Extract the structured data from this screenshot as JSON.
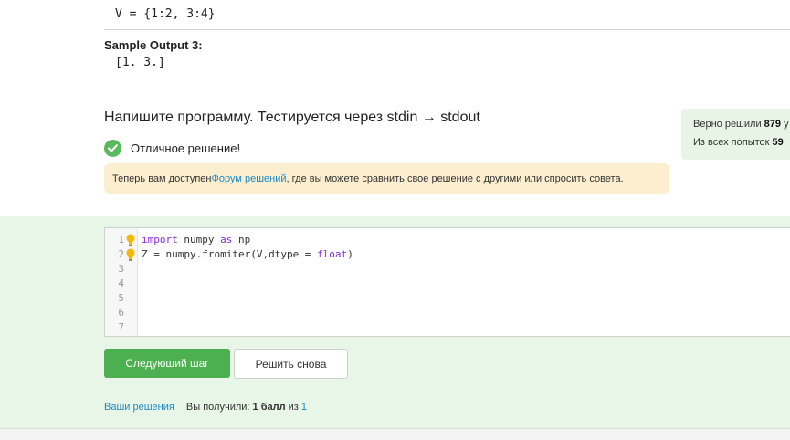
{
  "sample": {
    "input_value": "V = {1:2, 3:4}",
    "output_title": "Sample Output 3:",
    "output_value": "[1. 3.]"
  },
  "task": {
    "heading": "Напишите программу. Тестируется через stdin → stdout",
    "success_text": "Отличное решение!",
    "notice_before": "Теперь вам доступен ",
    "notice_link": "Форум решений",
    "notice_after": " , где вы можете сравнить свое решение с другими или спросить совета."
  },
  "stats": {
    "solved_label": "Верно решили ",
    "solved_value": "879",
    "solved_suffix": " у",
    "attempts_label": "Из всех попыток ",
    "attempts_value": "59"
  },
  "editor": {
    "lines": [
      {
        "num": "1",
        "parts": [
          [
            "import",
            "kw"
          ],
          [
            " numpy ",
            ""
          ],
          [
            "as",
            "kw"
          ],
          [
            " np",
            ""
          ]
        ],
        "hint": true
      },
      {
        "num": "2",
        "parts": [
          [
            "Z = numpy.fromiter(V,dtype = ",
            ""
          ],
          [
            "float",
            "kw"
          ],
          [
            ")",
            ""
          ]
        ],
        "hint": true
      },
      {
        "num": "3",
        "parts": [],
        "hint": false
      },
      {
        "num": "4",
        "parts": [],
        "hint": false
      },
      {
        "num": "5",
        "parts": [],
        "hint": false
      },
      {
        "num": "6",
        "parts": [],
        "hint": false
      },
      {
        "num": "7",
        "parts": [],
        "hint": false
      }
    ]
  },
  "buttons": {
    "next_label": "Следующий шаг",
    "retry_label": "Решить снова"
  },
  "footer": {
    "solutions_link": "Ваши решения",
    "received_label": "Вы получили: ",
    "score": "1 балл",
    "of_label": " из ",
    "total": "1"
  },
  "colors": {
    "accent_green": "#4caf50",
    "link_blue": "#1d89c6",
    "notice_bg": "#fcefcf",
    "band_bg": "#e8f6e8"
  }
}
